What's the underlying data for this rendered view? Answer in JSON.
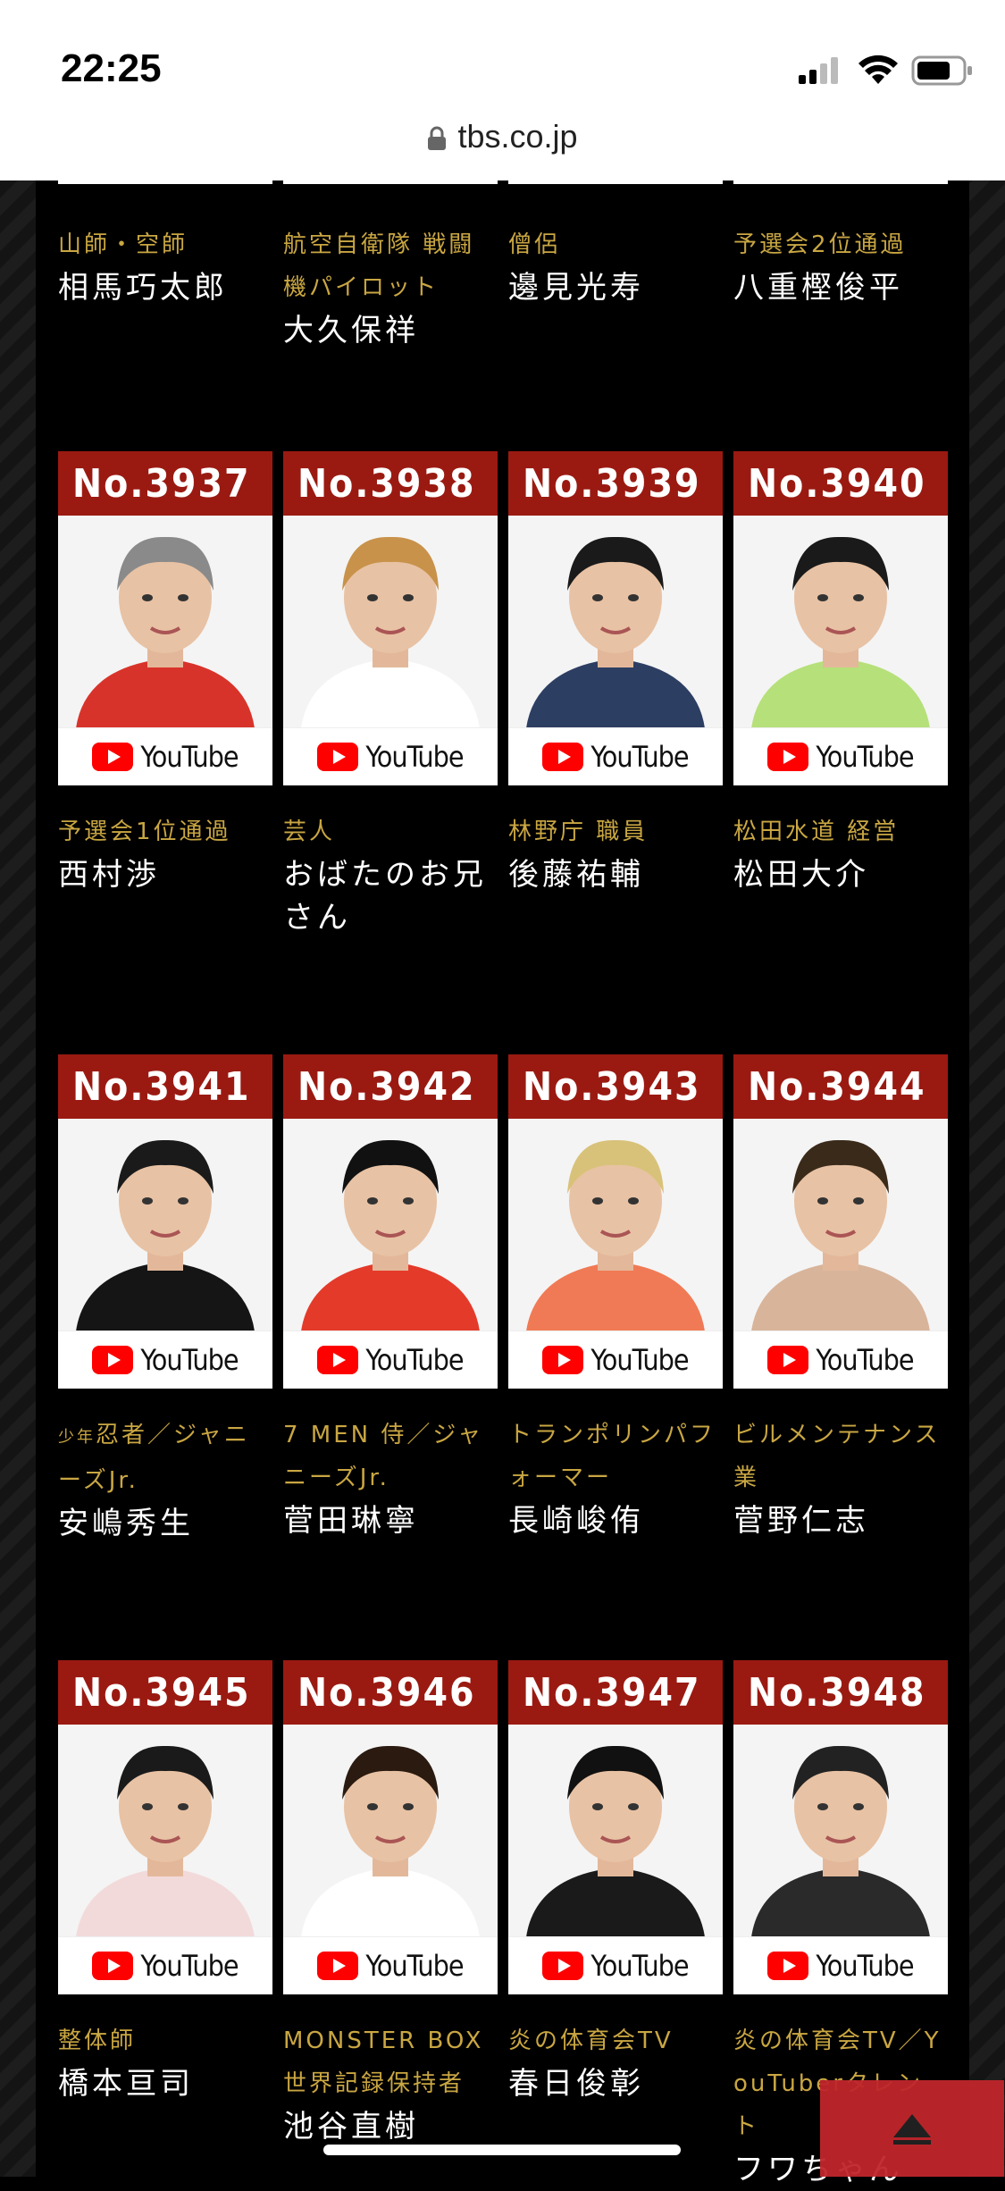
{
  "status_bar": {
    "time": "22:25"
  },
  "browser": {
    "url": "tbs.co.jp"
  },
  "youtube_label": "YouTube",
  "top_row": [
    {
      "role": "山師・空師",
      "name": "相馬巧太郎"
    },
    {
      "role": "航空自衛隊 戦闘機パイロット",
      "name": "大久保祥"
    },
    {
      "role": "僧侶",
      "name": "邊見光寿"
    },
    {
      "role": "予選会2位通過",
      "name": "八重樫俊平"
    }
  ],
  "rows": [
    [
      {
        "number": "No.3937",
        "role": "予選会1位通過",
        "name": "西村渉"
      },
      {
        "number": "No.3938",
        "role": "芸人",
        "name": "おばたのお兄さん"
      },
      {
        "number": "No.3939",
        "role": "林野庁 職員",
        "name": "後藤祐輔"
      },
      {
        "number": "No.3940",
        "role": "松田水道 経営",
        "name": "松田大介"
      }
    ],
    [
      {
        "number": "No.3941",
        "role_small": "少年",
        "role": "忍者／ジャニーズJr.",
        "name": "安嶋秀生"
      },
      {
        "number": "No.3942",
        "role": "7 MEN 侍／ジャニーズJr.",
        "name": "菅田琳寧"
      },
      {
        "number": "No.3943",
        "role": "トランポリンパフォーマー",
        "name": "長崎峻侑"
      },
      {
        "number": "No.3944",
        "role": "ビルメンテナンス業",
        "name": "菅野仁志"
      }
    ],
    [
      {
        "number": "No.3945",
        "role": "整体師",
        "name": "橋本亘司"
      },
      {
        "number": "No.3946",
        "role": "MONSTER BOX 世界記録保持者",
        "name": "池谷直樹"
      },
      {
        "number": "No.3947",
        "role": "炎の体育会TV",
        "name": "春日俊彰"
      },
      {
        "number": "No.3948",
        "role": "炎の体育会TV／YouTuberタレント",
        "name": "フワちゃん"
      }
    ]
  ],
  "colors": {
    "accent_red": "#9a1a12",
    "role_gold": "#c9a642",
    "button_red": "#c0262c"
  }
}
